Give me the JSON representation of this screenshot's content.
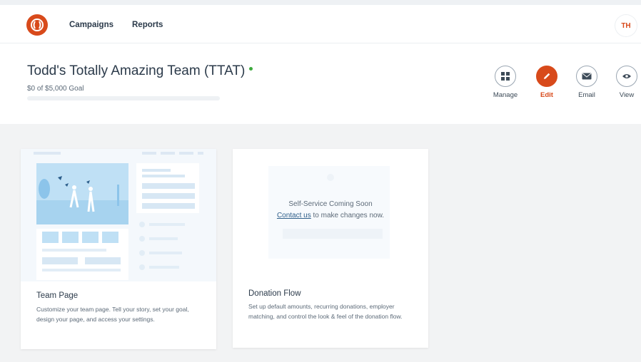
{
  "nav": {
    "campaigns": "Campaigns",
    "reports": "Reports",
    "avatar_initials": "TH"
  },
  "header": {
    "team_name": "Todd's Totally Amazing Team (TTAT)",
    "goal_text": "$0 of $5,000 Goal",
    "progress_fraction": 0,
    "actions": {
      "manage": "Manage",
      "edit": "Edit",
      "email": "Email",
      "view": "View"
    }
  },
  "cards": {
    "team_page": {
      "title": "Team Page",
      "description": "Customize your team page. Tell your story, set your goal, design your page, and access your settings."
    },
    "donation_flow": {
      "title": "Donation Flow",
      "description": "Set up default amounts, recurring donations, employer matching, and control the look & feel of the donation flow.",
      "coming_soon": "Self-Service Coming Soon",
      "contact_link": "Contact us",
      "contact_suffix": " to make changes now."
    }
  },
  "colors": {
    "brand": "#d84a1b",
    "status_active": "#3caa3c",
    "link": "#2f5f8a"
  }
}
